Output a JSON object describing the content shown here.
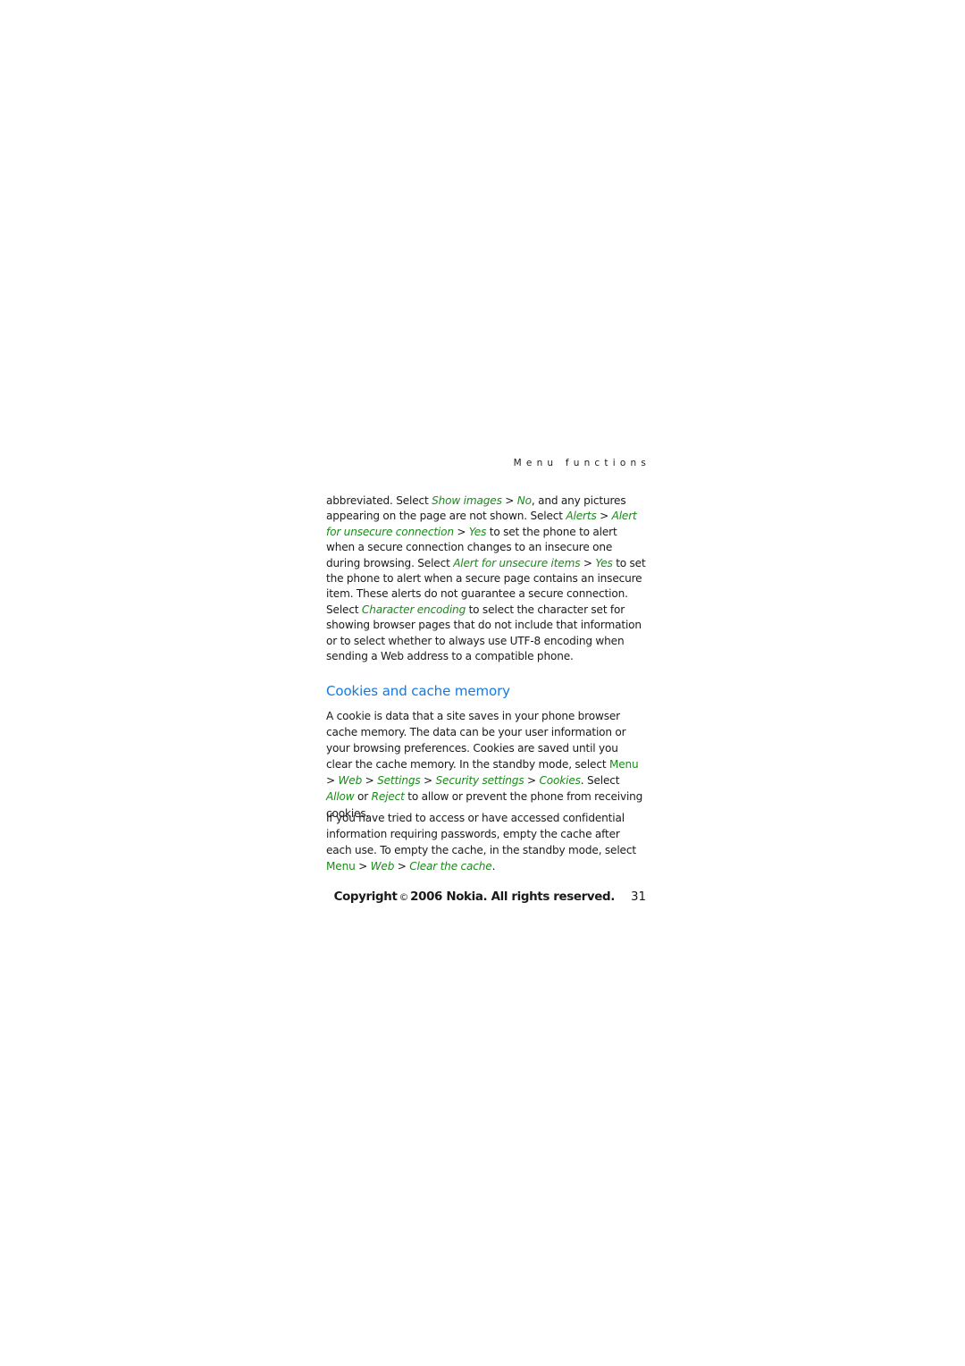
{
  "running_header": "Menu functions",
  "paragraph1": [
    {
      "t": "abbreviated. Select "
    },
    {
      "t": "Show images",
      "s": "gi"
    },
    {
      "t": " > "
    },
    {
      "t": "No",
      "s": "gi"
    },
    {
      "t": ", and any pictures appearing on the page are not shown. Select "
    },
    {
      "t": "Alerts",
      "s": "gi"
    },
    {
      "t": " > "
    },
    {
      "t": "Alert for unsecure connection",
      "s": "gi"
    },
    {
      "t": " > "
    },
    {
      "t": "Yes",
      "s": "gi"
    },
    {
      "t": " to set the phone to alert when a secure connection changes to an insecure one during browsing. Select "
    },
    {
      "t": "Alert for unsecure items",
      "s": "gi"
    },
    {
      "t": " > "
    },
    {
      "t": "Yes",
      "s": "gi"
    },
    {
      "t": " to set the phone to alert when a secure page contains an insecure item. These alerts do not guarantee a secure connection. Select "
    },
    {
      "t": "Character encoding",
      "s": "gi"
    },
    {
      "t": " to select the character set for showing browser pages that do not include that information or to select whether to always use UTF-8 encoding when sending a Web address to a compatible phone."
    }
  ],
  "section": {
    "heading": "Cookies and cache memory",
    "paragraph2": [
      {
        "t": "A cookie is data that a site saves in your phone browser cache memory. The data can be your user information or your browsing preferences. Cookies are saved until you clear the cache memory. In the standby mode, select "
      },
      {
        "t": "Menu",
        "s": "g"
      },
      {
        "t": " > "
      },
      {
        "t": "Web",
        "s": "gi"
      },
      {
        "t": " > "
      },
      {
        "t": "Settings",
        "s": "gi"
      },
      {
        "t": " > "
      },
      {
        "t": "Security settings",
        "s": "gi"
      },
      {
        "t": " > "
      },
      {
        "t": "Cookies",
        "s": "gi"
      },
      {
        "t": ". Select "
      },
      {
        "t": "Allow",
        "s": "gi"
      },
      {
        "t": " or "
      },
      {
        "t": "Reject",
        "s": "gi"
      },
      {
        "t": " to allow or prevent the phone from receiving cookies."
      }
    ],
    "paragraph3": [
      {
        "t": "If you have tried to access or have accessed confidential information requiring passwords, empty the cache after each use. To empty the cache, in the standby mode, select "
      },
      {
        "t": "Menu",
        "s": "g"
      },
      {
        "t": " > "
      },
      {
        "t": "Web",
        "s": "gi"
      },
      {
        "t": " > "
      },
      {
        "t": "Clear the cache",
        "s": "gi"
      },
      {
        "t": "."
      }
    ]
  },
  "footer": {
    "copyright_label": "Copyright",
    "copyright_symbol": "©",
    "copyright_text": "2006 Nokia. All rights reserved.",
    "page_number": "31"
  },
  "colors": {
    "heading_blue": "#1479e3",
    "menu_path_green": "#1a8a1a",
    "body_text": "#1a1a1a"
  }
}
